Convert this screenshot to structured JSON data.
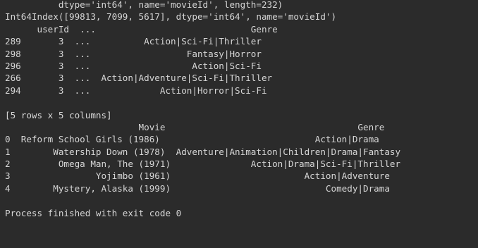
{
  "console": {
    "lines": [
      "          dtype='int64', name='movieId', length=232)",
      "Int64Index([99813, 7099, 5617], dtype='int64', name='movieId')",
      "      userId  ...                             Genre",
      "289       3  ...          Action|Sci-Fi|Thriller",
      "298       3  ...                  Fantasy|Horror",
      "296       3  ...                   Action|Sci-Fi",
      "266       3  ...  Action|Adventure|Sci-Fi|Thriller",
      "294       3  ...             Action|Horror|Sci-Fi",
      "",
      "[5 rows x 5 columns]",
      "                         Movie                                    Genre",
      "0  Reform School Girls (1986)                             Action|Drama",
      "1        Watership Down (1978)  Adventure|Animation|Children|Drama|Fantasy",
      "2         Omega Man, The (1971)               Action|Drama|Sci-Fi|Thriller",
      "3                Yojimbo (1961)                         Action|Adventure",
      "4        Mystery, Alaska (1999)                             Comedy|Drama",
      "",
      "Process finished with exit code 0"
    ]
  }
}
